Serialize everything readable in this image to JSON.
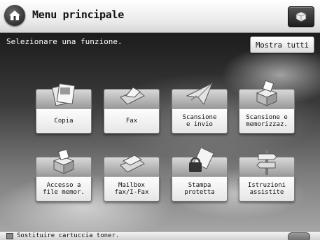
{
  "header": {
    "title": "Menu principale",
    "home_icon": "home-icon",
    "system_monitor_icon": "system-monitor-icon"
  },
  "main": {
    "instruction": "Selezionare una funzione.",
    "show_all_label": "Mostra tutti",
    "functions": [
      {
        "label": "Copia",
        "icon": "copy-icon"
      },
      {
        "label": "Fax",
        "icon": "fax-icon"
      },
      {
        "label": "Scansione\ne invio",
        "icon": "scan-send-icon"
      },
      {
        "label": "Scansione e\nmemorizzaz.",
        "icon": "scan-store-icon"
      },
      {
        "label": "Accesso a\nfile memor.",
        "icon": "access-stored-files-icon"
      },
      {
        "label": "Mailbox\nfax/I-Fax",
        "icon": "mailbox-icon"
      },
      {
        "label": "Stampa\nprotetta",
        "icon": "secure-print-icon"
      },
      {
        "label": "Istruzioni\nassistite",
        "icon": "guide-signpost-icon"
      }
    ]
  },
  "statusbar": {
    "message": "Sostituire cartuccia toner."
  },
  "colors": {
    "tile_top": "#b8b8b8",
    "tile_bottom": "#f4f4f4",
    "header": "#eeeeee"
  }
}
